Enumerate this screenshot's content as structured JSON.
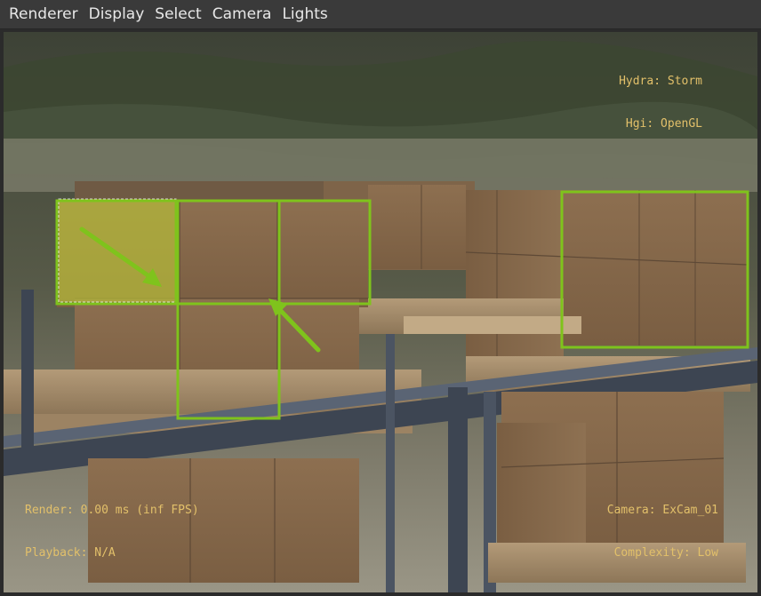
{
  "menubar": {
    "items": [
      "Renderer",
      "Display",
      "Select",
      "Camera",
      "Lights"
    ]
  },
  "hud": {
    "renderer_line": "Hydra: Storm",
    "hgi_line": "Hgi: OpenGL",
    "render_line": "Render: 0.00 ms (inf FPS)",
    "playback_line": "Playback: N/A",
    "camera_line": "Camera: ExCam_01",
    "complexity_line": "Complexity: Low"
  },
  "colors": {
    "hud_text": "#e2c06a",
    "highlight_box": "#7fc31c",
    "selection_fill": "#b4b83a",
    "box_cardboard": "#8a6c4c",
    "rack_steel": "#3d4552"
  },
  "icons": [
    "arrow-annotation-icon"
  ]
}
